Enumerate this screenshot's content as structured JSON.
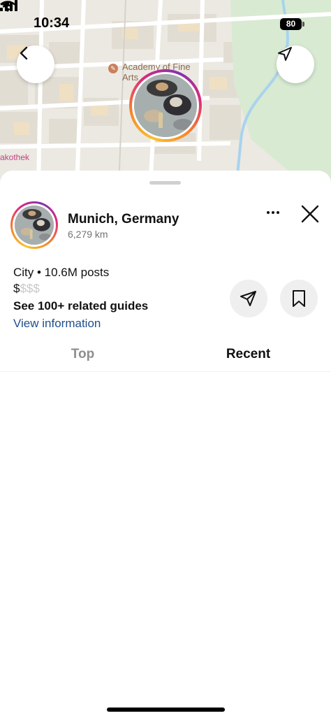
{
  "status_bar": {
    "time": "10:34",
    "battery": "80"
  },
  "map": {
    "poi_label_line1": "Academy of Fine",
    "poi_label_line2": "Arts",
    "edge_label": "akothek",
    "back_icon": "chevron-left-icon",
    "locate_icon": "location-arrow-icon"
  },
  "place": {
    "name": "Munich, Germany",
    "distance": "6,279 km",
    "category_line": "City • 10.6M posts",
    "price_active": "$",
    "price_inactive": "$$$",
    "guides_text": "See 100+ related guides",
    "view_info_text": "View information"
  },
  "tabs": [
    {
      "label": "Top",
      "selected": false
    },
    {
      "label": "Recent",
      "selected": true
    }
  ],
  "colors": {
    "link": "#1e4f8a",
    "muted": "#737373",
    "ring_gradient": [
      "#f9c22e",
      "#f58529",
      "#dd2a7b",
      "#8134af"
    ]
  }
}
